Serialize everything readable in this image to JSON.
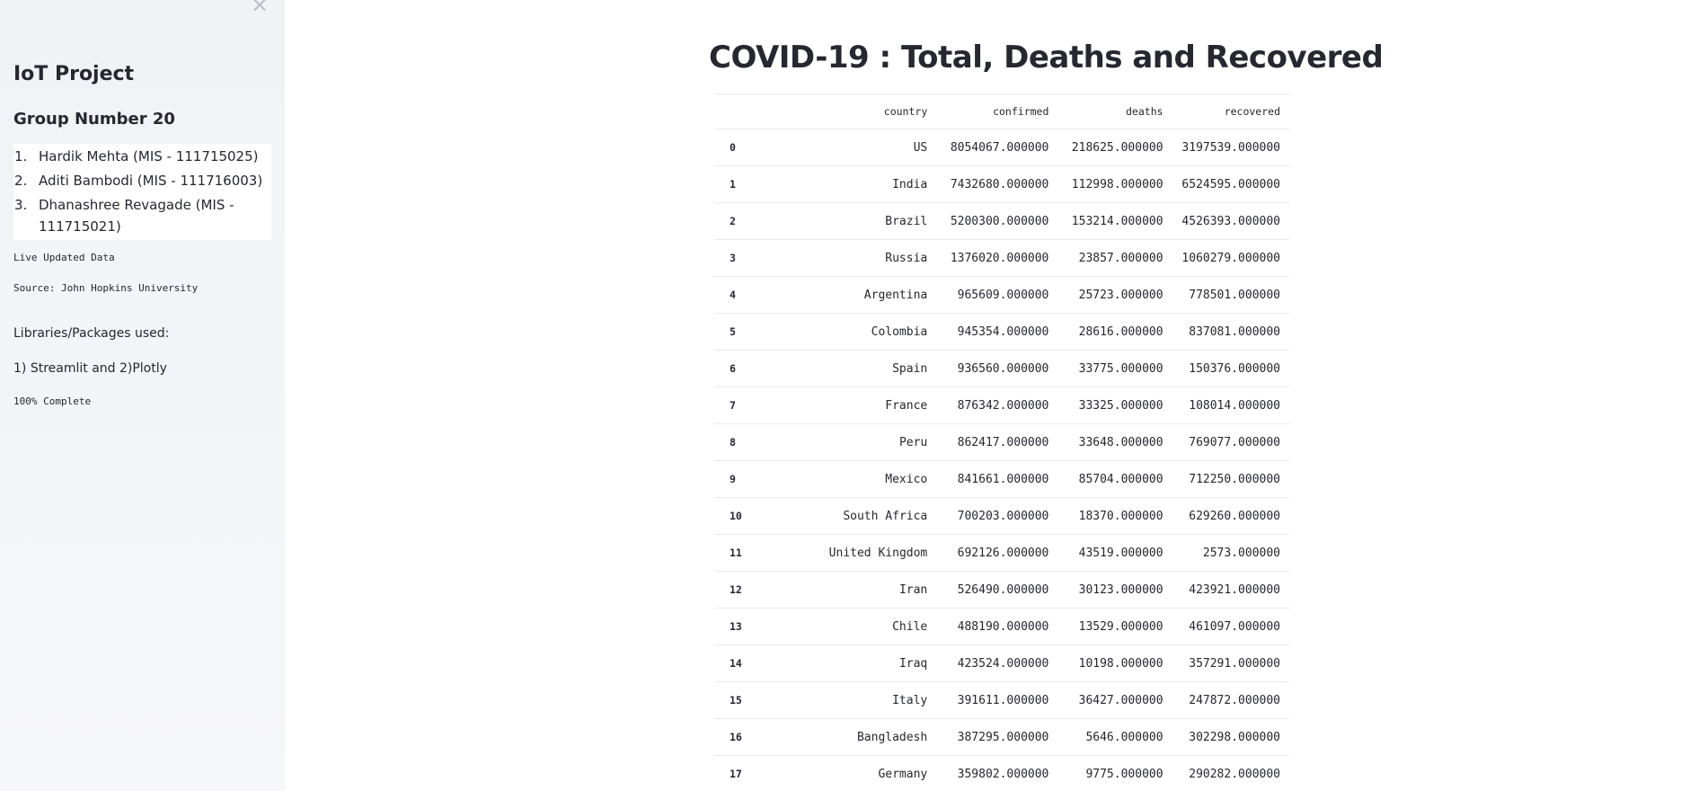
{
  "sidebar": {
    "close_label": "×",
    "title": "IoT Project",
    "group": "Group Number 20",
    "members": [
      {
        "num": "1.",
        "text": "Hardik Mehta (MIS - 111715025)"
      },
      {
        "num": "2.",
        "text": "Aditi Bambodi (MIS - 111716003)"
      },
      {
        "num": "3.",
        "text": "Dhanashree Revagade (MIS - 111715021)"
      }
    ],
    "live": "Live Updated Data",
    "source": "Source: John Hopkins University",
    "libraries_heading": "Libraries/Packages used:",
    "libraries": "1) Streamlit and 2)Plotly",
    "progress_text": "100% Complete",
    "progress_value": 100
  },
  "main": {
    "title": "COVID-19 : Total, Deaths and Recovered",
    "table": {
      "columns": [
        "",
        "country",
        "confirmed",
        "deaths",
        "recovered"
      ],
      "rows": [
        [
          "0",
          "US",
          "8054067.000000",
          "218625.000000",
          "3197539.000000"
        ],
        [
          "1",
          "India",
          "7432680.000000",
          "112998.000000",
          "6524595.000000"
        ],
        [
          "2",
          "Brazil",
          "5200300.000000",
          "153214.000000",
          "4526393.000000"
        ],
        [
          "3",
          "Russia",
          "1376020.000000",
          "23857.000000",
          "1060279.000000"
        ],
        [
          "4",
          "Argentina",
          "965609.000000",
          "25723.000000",
          "778501.000000"
        ],
        [
          "5",
          "Colombia",
          "945354.000000",
          "28616.000000",
          "837081.000000"
        ],
        [
          "6",
          "Spain",
          "936560.000000",
          "33775.000000",
          "150376.000000"
        ],
        [
          "7",
          "France",
          "876342.000000",
          "33325.000000",
          "108014.000000"
        ],
        [
          "8",
          "Peru",
          "862417.000000",
          "33648.000000",
          "769077.000000"
        ],
        [
          "9",
          "Mexico",
          "841661.000000",
          "85704.000000",
          "712250.000000"
        ],
        [
          "10",
          "South Africa",
          "700203.000000",
          "18370.000000",
          "629260.000000"
        ],
        [
          "11",
          "United Kingdom",
          "692126.000000",
          "43519.000000",
          "2573.000000"
        ],
        [
          "12",
          "Iran",
          "526490.000000",
          "30123.000000",
          "423921.000000"
        ],
        [
          "13",
          "Chile",
          "488190.000000",
          "13529.000000",
          "461097.000000"
        ],
        [
          "14",
          "Iraq",
          "423524.000000",
          "10198.000000",
          "357291.000000"
        ],
        [
          "15",
          "Italy",
          "391611.000000",
          "36427.000000",
          "247872.000000"
        ],
        [
          "16",
          "Bangladesh",
          "387295.000000",
          "5646.000000",
          "302298.000000"
        ],
        [
          "17",
          "Germany",
          "359802.000000",
          "9775.000000",
          "290282.000000"
        ]
      ]
    }
  },
  "colors": {
    "sidebar_bg": "#f0f2f6",
    "text": "#262730",
    "border": "#e6e9ef",
    "close_icon": "#b9bcc3"
  }
}
